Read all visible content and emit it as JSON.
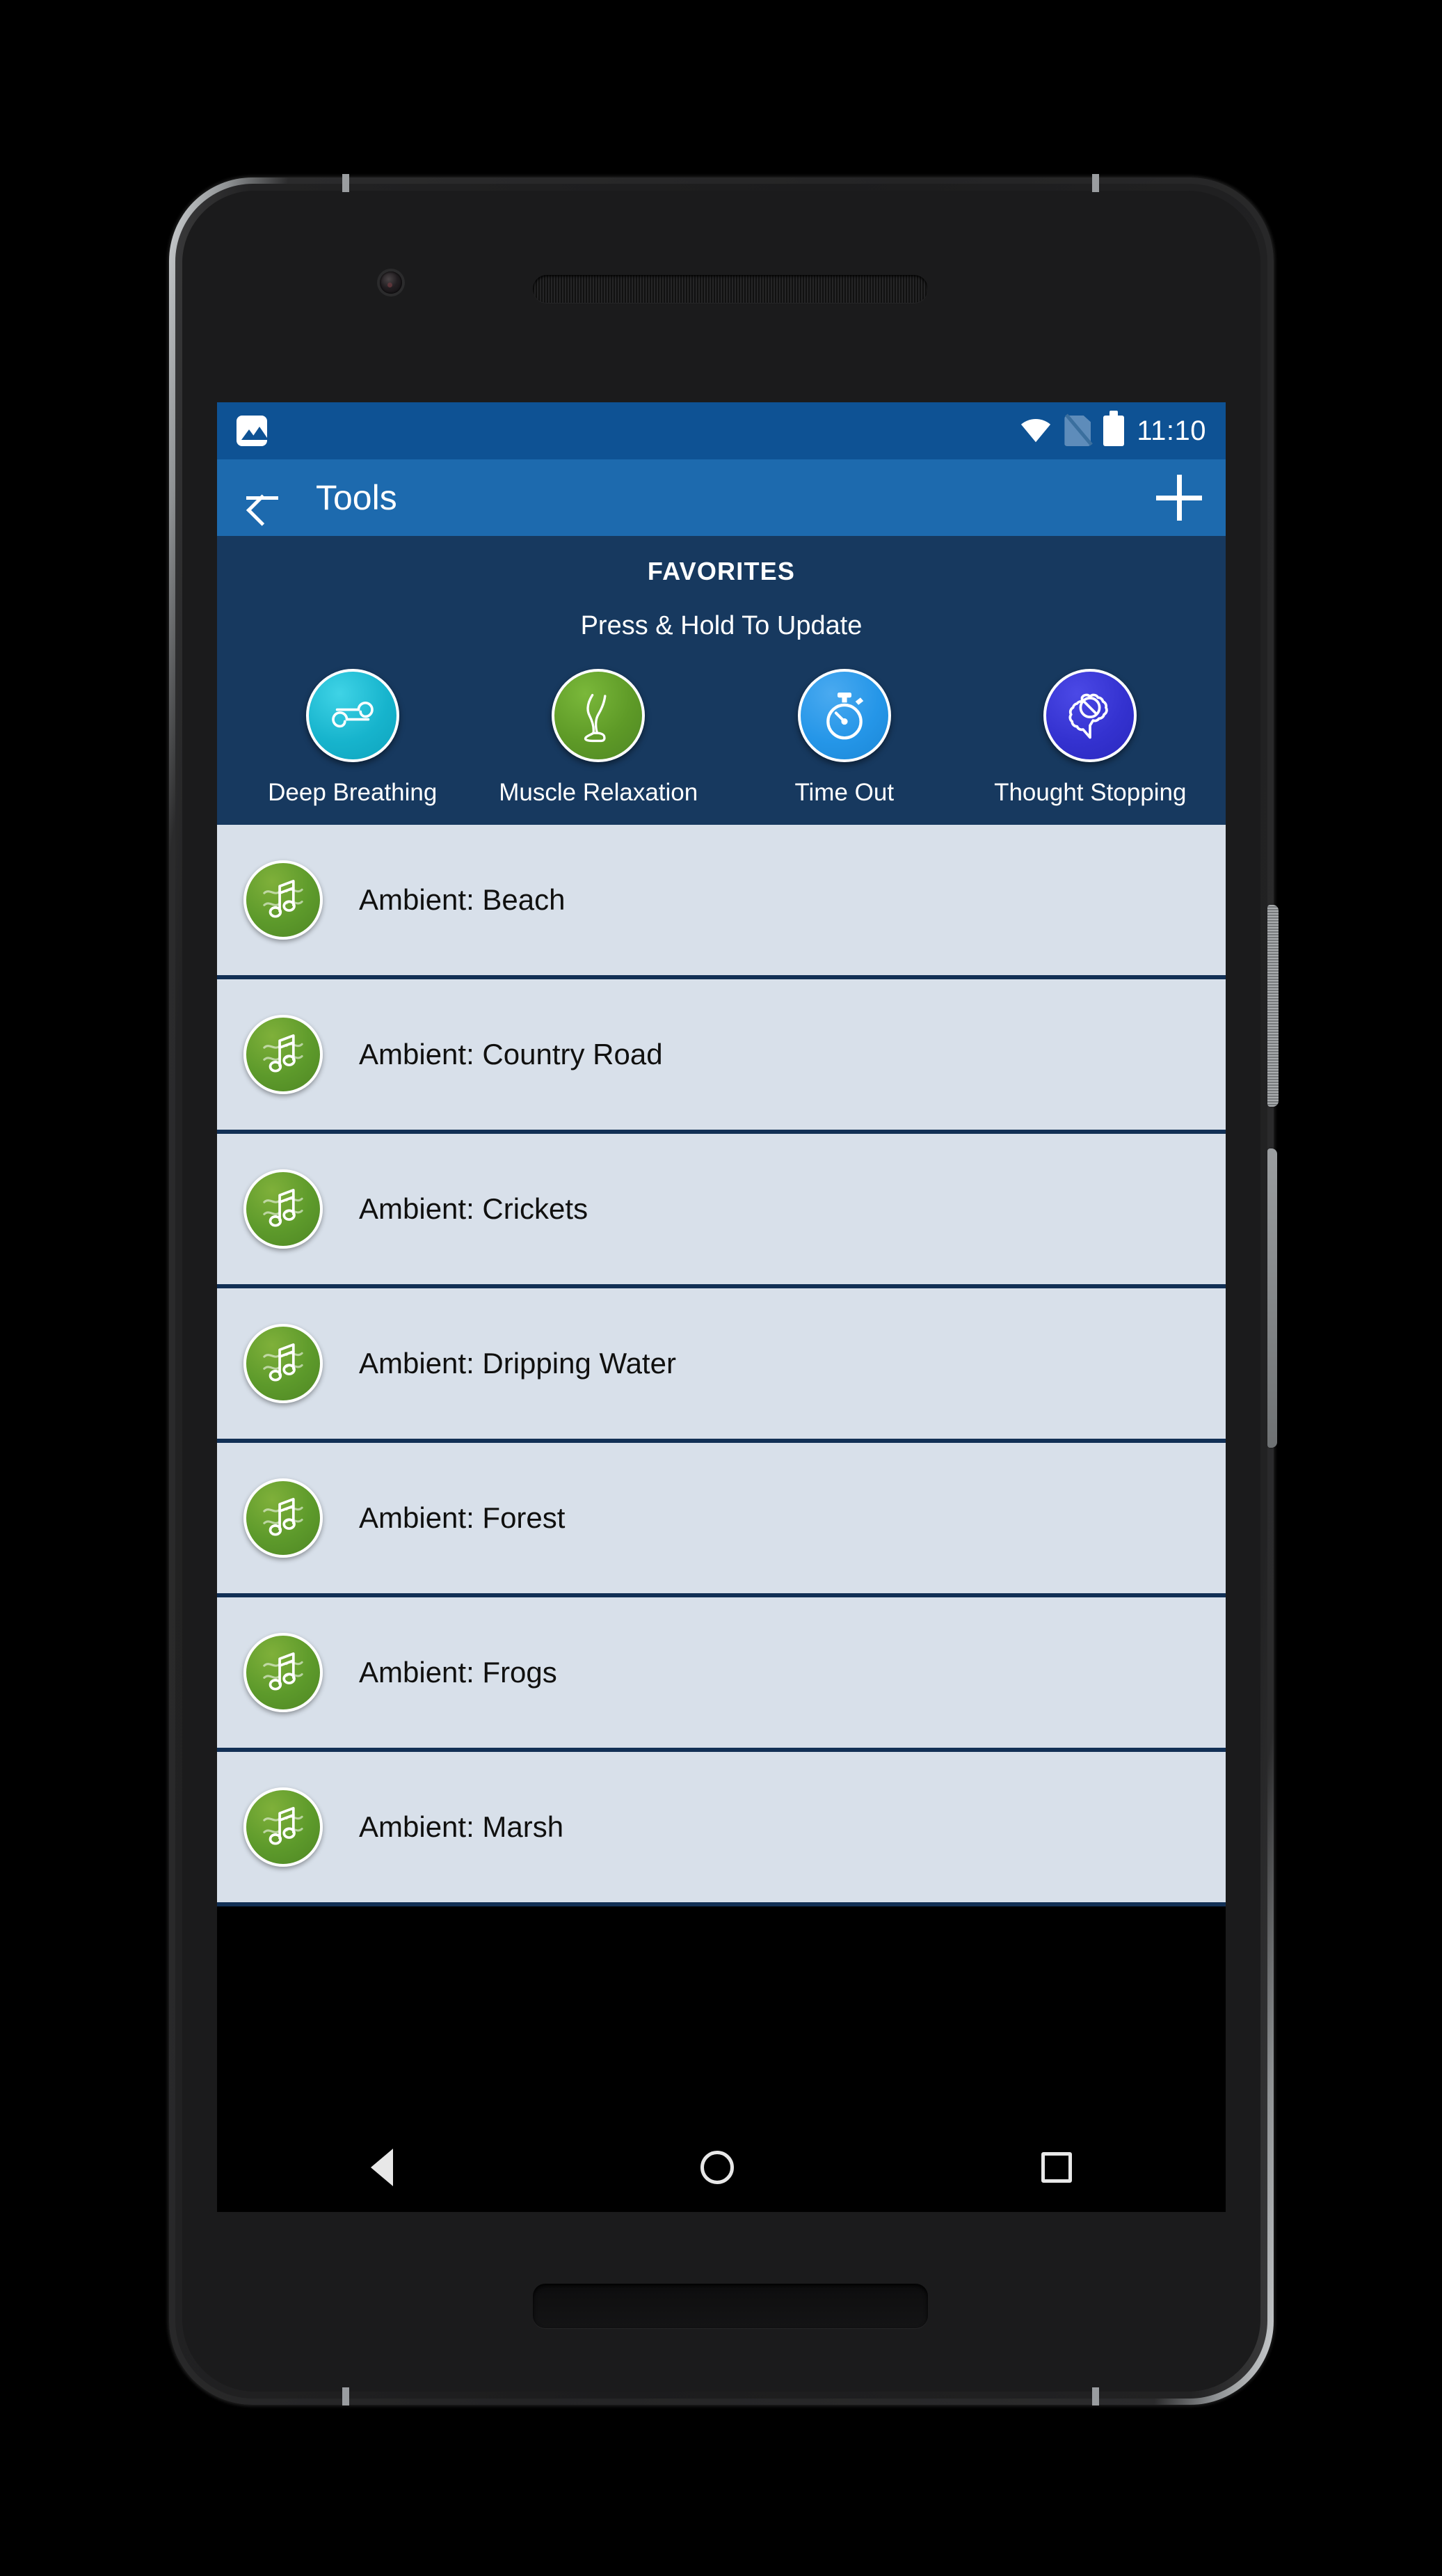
{
  "device": {
    "hardware": {
      "front_camera": "front-camera",
      "earpiece": "earpiece-speaker",
      "bottom_speaker": "bottom-speaker-grille",
      "power_button": "power-button",
      "volume_button": "volume-rocker"
    }
  },
  "status_bar": {
    "notification_icon": "screenshot-image-icon",
    "wifi_icon": "wifi-icon",
    "sim_icon": "no-sim-card-icon",
    "battery_icon": "battery-full-icon",
    "time": "11:10",
    "background_color": "#0e5294"
  },
  "app_bar": {
    "back_icon": "back-arrow-icon",
    "title": "Tools",
    "add_icon": "plus-add-icon",
    "background_color": "#1d6aae"
  },
  "favorites": {
    "heading": "FAVORITES",
    "subtitle": "Press & Hold To Update",
    "background_color": "#17395f",
    "items": [
      {
        "label": "Deep Breathing",
        "icon": "wind-breath-icon",
        "color": "#19b6cf"
      },
      {
        "label": "Muscle Relaxation",
        "icon": "leg-muscle-icon",
        "color": "#5e9a27"
      },
      {
        "label": "Time Out",
        "icon": "stopwatch-timer-icon",
        "color": "#2596e8"
      },
      {
        "label": "Thought Stopping",
        "icon": "brain-no-entry-icon",
        "color": "#3432d0"
      }
    ]
  },
  "tool_list": {
    "row_background_color": "#d8e0ea",
    "divider_color": "#123055",
    "icon_color": "#5d9a2b",
    "items": [
      {
        "label": "Ambient: Beach",
        "icon": "music-note-wave-icon"
      },
      {
        "label": "Ambient: Country Road",
        "icon": "music-note-wave-icon"
      },
      {
        "label": "Ambient: Crickets",
        "icon": "music-note-wave-icon"
      },
      {
        "label": "Ambient: Dripping Water",
        "icon": "music-note-wave-icon"
      },
      {
        "label": "Ambient: Forest",
        "icon": "music-note-wave-icon"
      },
      {
        "label": "Ambient: Frogs",
        "icon": "music-note-wave-icon"
      },
      {
        "label": "Ambient: Marsh",
        "icon": "music-note-wave-icon"
      }
    ]
  },
  "nav_bar": {
    "back": "navigation-back-triangle-icon",
    "home": "navigation-home-circle-icon",
    "recents": "navigation-recents-square-icon"
  }
}
